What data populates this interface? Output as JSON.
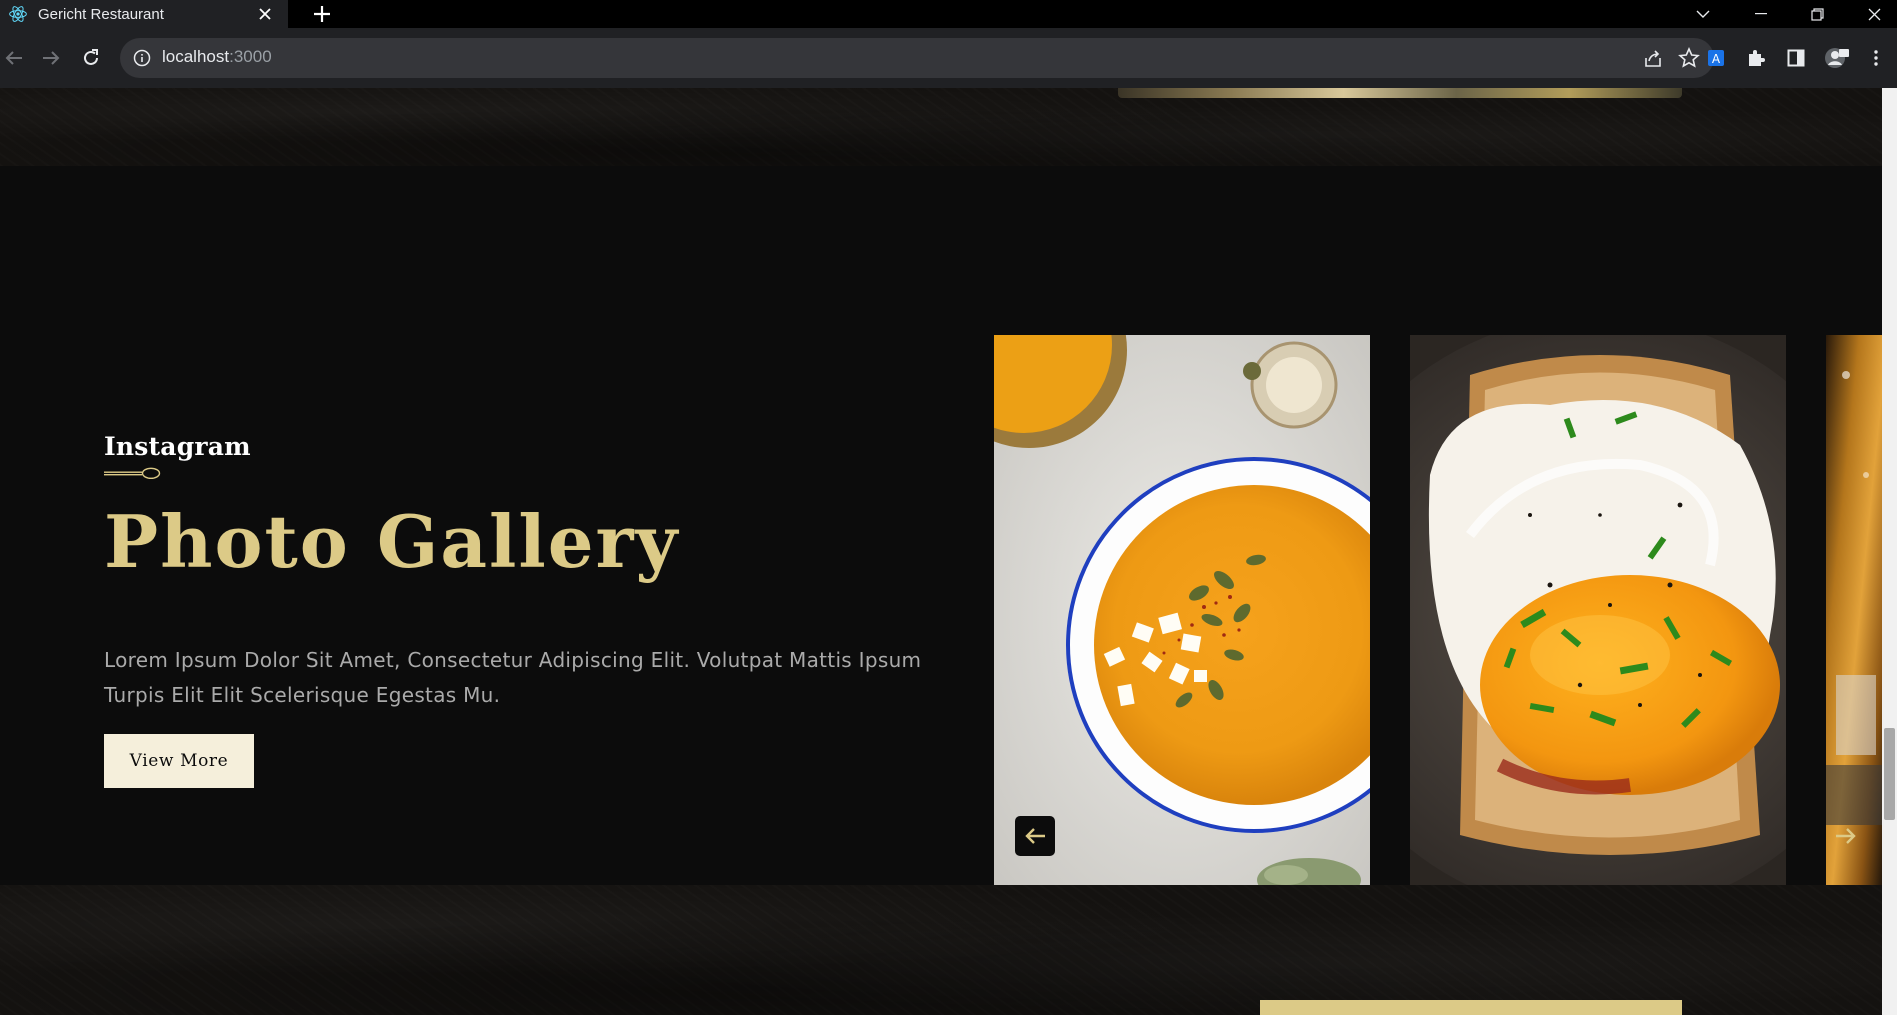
{
  "browser": {
    "tab_title": "Gericht Restaurant",
    "url_host": "localhost",
    "url_port": ":3000"
  },
  "gallery": {
    "subtitle": "Instagram",
    "heading": "Photo Gallery",
    "description": "Lorem Ipsum Dolor Sit Amet, Consectetur Adipiscing Elit. Volutpat Mattis Ipsum Turpis Elit Elit Scelerisque Egestas Mu.",
    "button_label": "View More",
    "images": [
      "soup-bowl-image",
      "fried-egg-toast-image",
      "drink-image-partial"
    ]
  },
  "colors": {
    "golden": "#dcca87",
    "black": "#0c0c0c",
    "crimson": "#f5efdb",
    "grey": "#aaaaaa"
  },
  "icons": [
    "react-icon",
    "close-icon",
    "plus-icon",
    "chevron-down-icon",
    "minimize-icon",
    "restore-icon",
    "close-window-icon",
    "back-icon",
    "forward-icon",
    "reload-icon",
    "info-icon",
    "share-icon",
    "star-icon",
    "extension-icon",
    "puzzle-icon",
    "sidepanel-icon",
    "profile-icon",
    "menu-icon",
    "spoon-icon",
    "arrow-left-icon",
    "arrow-right-icon"
  ]
}
